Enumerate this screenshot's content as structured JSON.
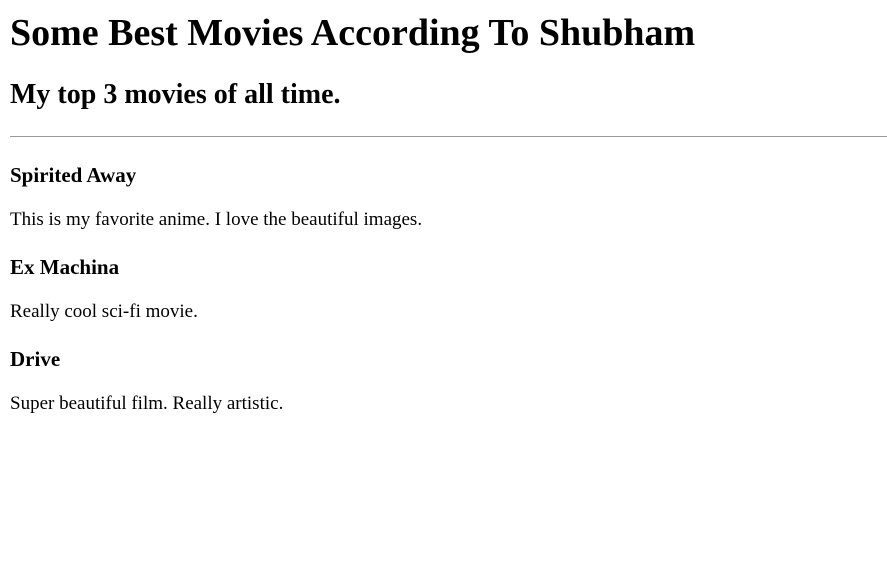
{
  "header": {
    "title": "Some Best Movies According To Shubham",
    "subtitle": "My top 3 movies of all time."
  },
  "movies": [
    {
      "title": "Spirited Away",
      "description": "This is my favorite anime. I love the beautiful images."
    },
    {
      "title": "Ex Machina",
      "description": "Really cool sci-fi movie."
    },
    {
      "title": "Drive",
      "description": "Super beautiful film. Really artistic."
    }
  ]
}
